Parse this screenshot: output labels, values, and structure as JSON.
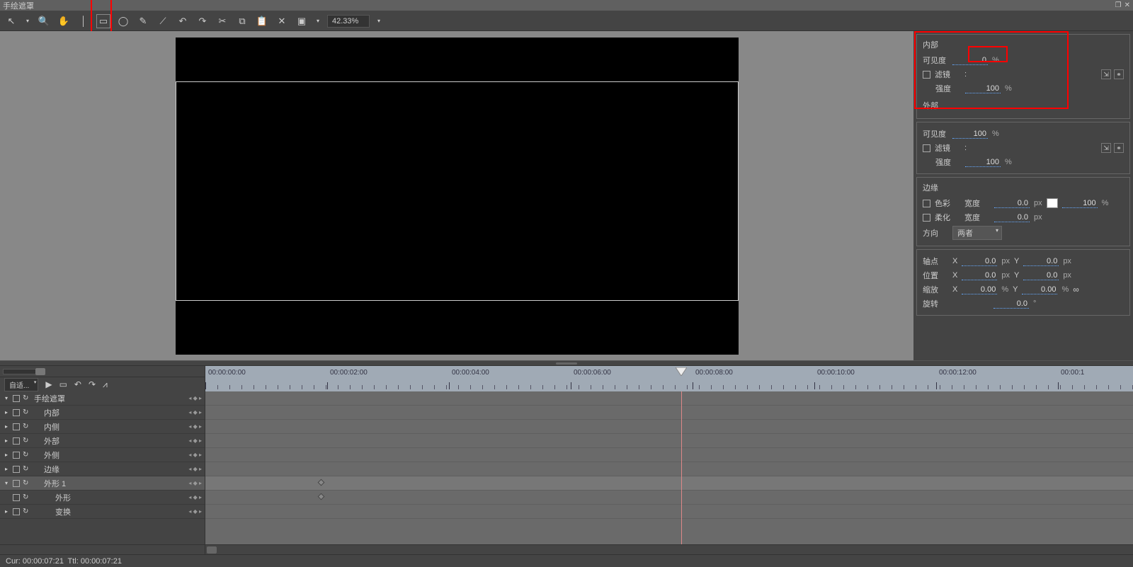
{
  "title": "手绘遮罩",
  "window_controls": {
    "restore": "❐",
    "close": "✕"
  },
  "toolbar": {
    "arrow": "↖",
    "zoom": "🔍",
    "hand": "✋",
    "line": "│",
    "rect": "▭",
    "ellipse": "◯",
    "pen": "✎",
    "node": "⟋",
    "undo": "↶",
    "redo": "↷",
    "cut": "✂",
    "copy": "⧉",
    "paste": "📋",
    "delete": "✕",
    "crop": "▣",
    "zoom_value": "42.33%",
    "dd": "▾"
  },
  "side": {
    "inner": {
      "title": "内部",
      "visibility_lbl": "可见度",
      "visibility": "0",
      "visibility_unit": "%",
      "filter_lbl": "滤镜",
      "filter_sep": ":",
      "intensity_lbl": "强度",
      "intensity": "100",
      "intensity_unit": "%"
    },
    "outer": {
      "title": "外部",
      "visibility_lbl": "可见度",
      "visibility": "100",
      "visibility_unit": "%",
      "filter_lbl": "滤镜",
      "filter_sep": ":",
      "intensity_lbl": "强度",
      "intensity": "100",
      "intensity_unit": "%"
    },
    "edge": {
      "title": "边缘",
      "color_lbl": "色彩",
      "width1_lbl": "宽度",
      "width1": "0.0",
      "width1_unit": "px",
      "pct": "100",
      "pct_unit": "%",
      "soft_lbl": "柔化",
      "width2_lbl": "宽度",
      "width2": "0.0",
      "width2_unit": "px",
      "dir_lbl": "方向",
      "dir_val": "两者"
    },
    "transform": {
      "pivot_lbl": "轴点",
      "pos_lbl": "位置",
      "scale_lbl": "缩放",
      "rot_lbl": "旋转",
      "x": "X",
      "y": "Y",
      "px": "px",
      "pct": "%",
      "deg": "°",
      "pivot_x": "0.0",
      "pivot_y": "0.0",
      "pos_x": "0.0",
      "pos_y": "0.0",
      "scale_x": "0.00",
      "scale_y": "0.00",
      "rot": "0.0"
    },
    "mini_import": "⇲",
    "mini_lock": "⚭"
  },
  "timeline": {
    "fit_label": "自适...",
    "play": "▶",
    "loop": "▭",
    "prev": "↶",
    "next": "↷",
    "graph": "⩘",
    "ticks": [
      "00:00:00:00",
      "00:00:02:00",
      "00:00:04:00",
      "00:00:06:00",
      "00:00:08:00",
      "00:00:10:00",
      "00:00:12:00",
      "00:00:1"
    ],
    "playhead_pct": 51.3,
    "tracks": [
      {
        "name": "手绘遮罩",
        "indent": 0,
        "exp": "▾",
        "sel": false,
        "kf": false
      },
      {
        "name": "内部",
        "indent": 1,
        "exp": "▸",
        "sel": false,
        "kf": false
      },
      {
        "name": "内侧",
        "indent": 1,
        "exp": "▸",
        "sel": false,
        "kf": false
      },
      {
        "name": "外部",
        "indent": 1,
        "exp": "▸",
        "sel": false,
        "kf": false
      },
      {
        "name": "外侧",
        "indent": 1,
        "exp": "▸",
        "sel": false,
        "kf": false
      },
      {
        "name": "边缘",
        "indent": 1,
        "exp": "▸",
        "sel": false,
        "kf": false
      },
      {
        "name": "外形 1",
        "indent": 1,
        "exp": "▾",
        "sel": true,
        "kf": true
      },
      {
        "name": "外形",
        "indent": 2,
        "exp": "",
        "sel": false,
        "kf": true
      },
      {
        "name": "变换",
        "indent": 2,
        "exp": "▸",
        "sel": false,
        "kf": false
      }
    ]
  },
  "status": {
    "cur": "Cur: 00:00:07:21",
    "ttl": "Ttl: 00:00:07:21"
  }
}
